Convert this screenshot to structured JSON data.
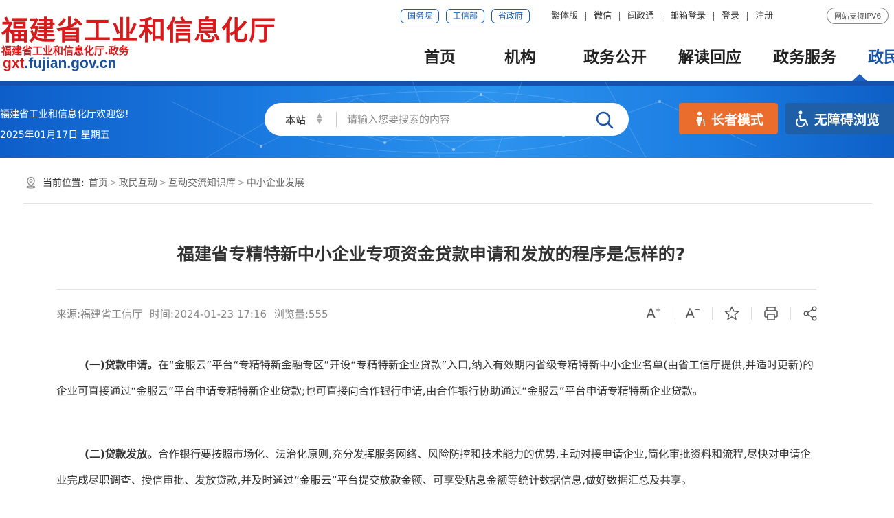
{
  "header": {
    "site_name": "福建省工业和信息化厅",
    "site_sub": "福建省工业和信息化厅.政务",
    "domain_prefix": "gxt",
    "domain_rest": ".fujian.gov.cn",
    "top_pills": [
      "国务院",
      "工信部",
      "省政府"
    ],
    "util_links": [
      "繁体版",
      "微信",
      "闽政通",
      "邮箱登录",
      "登录",
      "注册"
    ],
    "ipv6": "网站支持IPV6",
    "nav": [
      "首页",
      "机构",
      "政务公开",
      "解读回应",
      "政务服务",
      "政民互动"
    ],
    "active_nav": "政民互动"
  },
  "banner": {
    "welcome": "福建省工业和信息化厅欢迎您!",
    "date": "2025年01月17日 星期五",
    "search_scope": "本站",
    "search_placeholder": "请输入您要搜索的内容",
    "elder_label": "长者模式",
    "access_label": "无障碍浏览",
    "colors": {
      "elder": "#ea6d2e",
      "access": "#1f5fa8",
      "banner": "#1a7ae0"
    }
  },
  "breadcrumb": {
    "label": "当前位置:",
    "items": [
      "首页",
      "政民互动",
      "互动交流知识库",
      "中小企业发展"
    ]
  },
  "article": {
    "title": "福建省专精特新中小企业专项资金贷款申请和发放的程序是怎样的?",
    "source": "来源:福建省工信厅",
    "time": "时间:2024-01-23 17:16",
    "views": "浏览量:555",
    "tools": [
      "font-increase-icon",
      "font-decrease-icon",
      "star-icon",
      "print-icon",
      "share-icon"
    ],
    "p1_head": "(一)贷款申请。",
    "p1_body": "在“金服云”平台“专精特新金融专区”开设“专精特新企业贷款”入口,纳入有效期内省级专精特新中小企业名单(由省工信厅提供,并适时更新)的企业可直接通过“金服云”平台申请专精特新企业贷款;也可直接向合作银行申请,由合作银行协助通过“金服云”平台申请专精特新企业贷款。",
    "p2_head": "(二)贷款发放。",
    "p2_body": "合作银行要按照市场化、法治化原则,充分发挥服务网络、风险防控和技术能力的优势,主动对接申请企业,简化审批资料和流程,尽快对申请企业完成尽职调查、授信审批、发放贷款,并及时通过“金服云”平台提交放款金额、可享受贴息金额等统计数据信息,做好数据汇总及共享。"
  }
}
